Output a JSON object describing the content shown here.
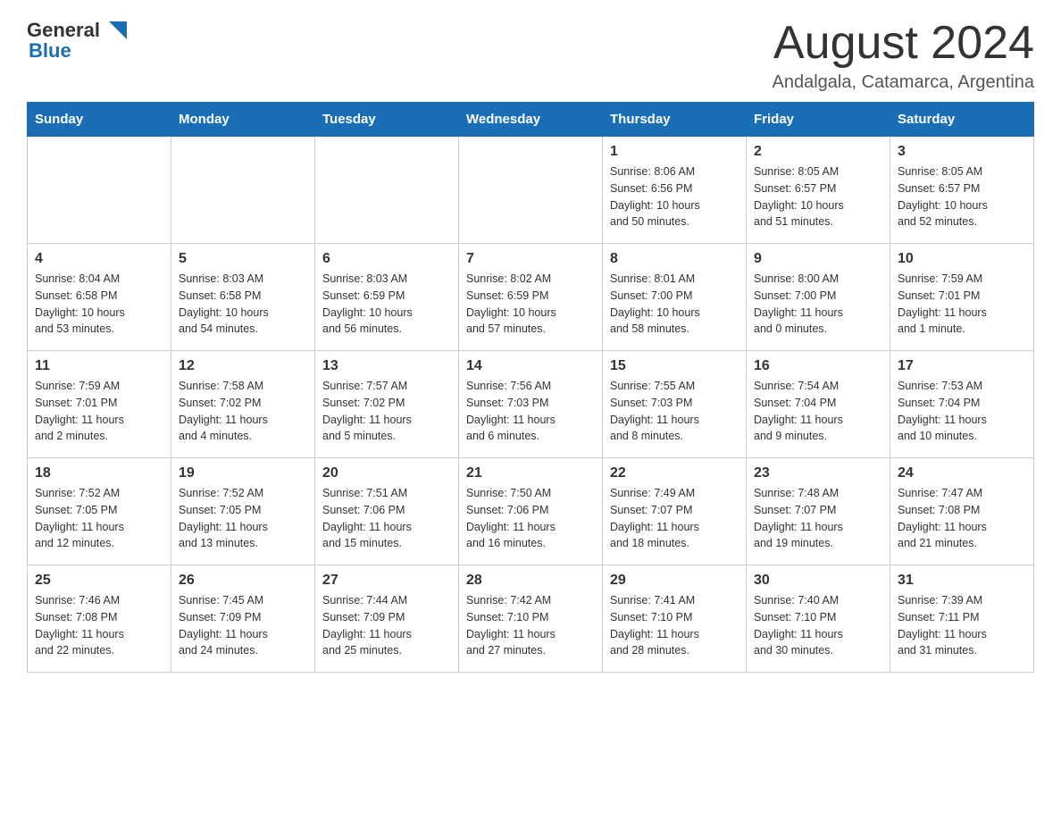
{
  "header": {
    "logo_text_general": "General",
    "logo_text_blue": "Blue",
    "month_title": "August 2024",
    "location": "Andalgala, Catamarca, Argentina"
  },
  "calendar": {
    "days_of_week": [
      "Sunday",
      "Monday",
      "Tuesday",
      "Wednesday",
      "Thursday",
      "Friday",
      "Saturday"
    ],
    "weeks": [
      [
        {
          "day": "",
          "info": ""
        },
        {
          "day": "",
          "info": ""
        },
        {
          "day": "",
          "info": ""
        },
        {
          "day": "",
          "info": ""
        },
        {
          "day": "1",
          "info": "Sunrise: 8:06 AM\nSunset: 6:56 PM\nDaylight: 10 hours\nand 50 minutes."
        },
        {
          "day": "2",
          "info": "Sunrise: 8:05 AM\nSunset: 6:57 PM\nDaylight: 10 hours\nand 51 minutes."
        },
        {
          "day": "3",
          "info": "Sunrise: 8:05 AM\nSunset: 6:57 PM\nDaylight: 10 hours\nand 52 minutes."
        }
      ],
      [
        {
          "day": "4",
          "info": "Sunrise: 8:04 AM\nSunset: 6:58 PM\nDaylight: 10 hours\nand 53 minutes."
        },
        {
          "day": "5",
          "info": "Sunrise: 8:03 AM\nSunset: 6:58 PM\nDaylight: 10 hours\nand 54 minutes."
        },
        {
          "day": "6",
          "info": "Sunrise: 8:03 AM\nSunset: 6:59 PM\nDaylight: 10 hours\nand 56 minutes."
        },
        {
          "day": "7",
          "info": "Sunrise: 8:02 AM\nSunset: 6:59 PM\nDaylight: 10 hours\nand 57 minutes."
        },
        {
          "day": "8",
          "info": "Sunrise: 8:01 AM\nSunset: 7:00 PM\nDaylight: 10 hours\nand 58 minutes."
        },
        {
          "day": "9",
          "info": "Sunrise: 8:00 AM\nSunset: 7:00 PM\nDaylight: 11 hours\nand 0 minutes."
        },
        {
          "day": "10",
          "info": "Sunrise: 7:59 AM\nSunset: 7:01 PM\nDaylight: 11 hours\nand 1 minute."
        }
      ],
      [
        {
          "day": "11",
          "info": "Sunrise: 7:59 AM\nSunset: 7:01 PM\nDaylight: 11 hours\nand 2 minutes."
        },
        {
          "day": "12",
          "info": "Sunrise: 7:58 AM\nSunset: 7:02 PM\nDaylight: 11 hours\nand 4 minutes."
        },
        {
          "day": "13",
          "info": "Sunrise: 7:57 AM\nSunset: 7:02 PM\nDaylight: 11 hours\nand 5 minutes."
        },
        {
          "day": "14",
          "info": "Sunrise: 7:56 AM\nSunset: 7:03 PM\nDaylight: 11 hours\nand 6 minutes."
        },
        {
          "day": "15",
          "info": "Sunrise: 7:55 AM\nSunset: 7:03 PM\nDaylight: 11 hours\nand 8 minutes."
        },
        {
          "day": "16",
          "info": "Sunrise: 7:54 AM\nSunset: 7:04 PM\nDaylight: 11 hours\nand 9 minutes."
        },
        {
          "day": "17",
          "info": "Sunrise: 7:53 AM\nSunset: 7:04 PM\nDaylight: 11 hours\nand 10 minutes."
        }
      ],
      [
        {
          "day": "18",
          "info": "Sunrise: 7:52 AM\nSunset: 7:05 PM\nDaylight: 11 hours\nand 12 minutes."
        },
        {
          "day": "19",
          "info": "Sunrise: 7:52 AM\nSunset: 7:05 PM\nDaylight: 11 hours\nand 13 minutes."
        },
        {
          "day": "20",
          "info": "Sunrise: 7:51 AM\nSunset: 7:06 PM\nDaylight: 11 hours\nand 15 minutes."
        },
        {
          "day": "21",
          "info": "Sunrise: 7:50 AM\nSunset: 7:06 PM\nDaylight: 11 hours\nand 16 minutes."
        },
        {
          "day": "22",
          "info": "Sunrise: 7:49 AM\nSunset: 7:07 PM\nDaylight: 11 hours\nand 18 minutes."
        },
        {
          "day": "23",
          "info": "Sunrise: 7:48 AM\nSunset: 7:07 PM\nDaylight: 11 hours\nand 19 minutes."
        },
        {
          "day": "24",
          "info": "Sunrise: 7:47 AM\nSunset: 7:08 PM\nDaylight: 11 hours\nand 21 minutes."
        }
      ],
      [
        {
          "day": "25",
          "info": "Sunrise: 7:46 AM\nSunset: 7:08 PM\nDaylight: 11 hours\nand 22 minutes."
        },
        {
          "day": "26",
          "info": "Sunrise: 7:45 AM\nSunset: 7:09 PM\nDaylight: 11 hours\nand 24 minutes."
        },
        {
          "day": "27",
          "info": "Sunrise: 7:44 AM\nSunset: 7:09 PM\nDaylight: 11 hours\nand 25 minutes."
        },
        {
          "day": "28",
          "info": "Sunrise: 7:42 AM\nSunset: 7:10 PM\nDaylight: 11 hours\nand 27 minutes."
        },
        {
          "day": "29",
          "info": "Sunrise: 7:41 AM\nSunset: 7:10 PM\nDaylight: 11 hours\nand 28 minutes."
        },
        {
          "day": "30",
          "info": "Sunrise: 7:40 AM\nSunset: 7:10 PM\nDaylight: 11 hours\nand 30 minutes."
        },
        {
          "day": "31",
          "info": "Sunrise: 7:39 AM\nSunset: 7:11 PM\nDaylight: 11 hours\nand 31 minutes."
        }
      ]
    ]
  }
}
